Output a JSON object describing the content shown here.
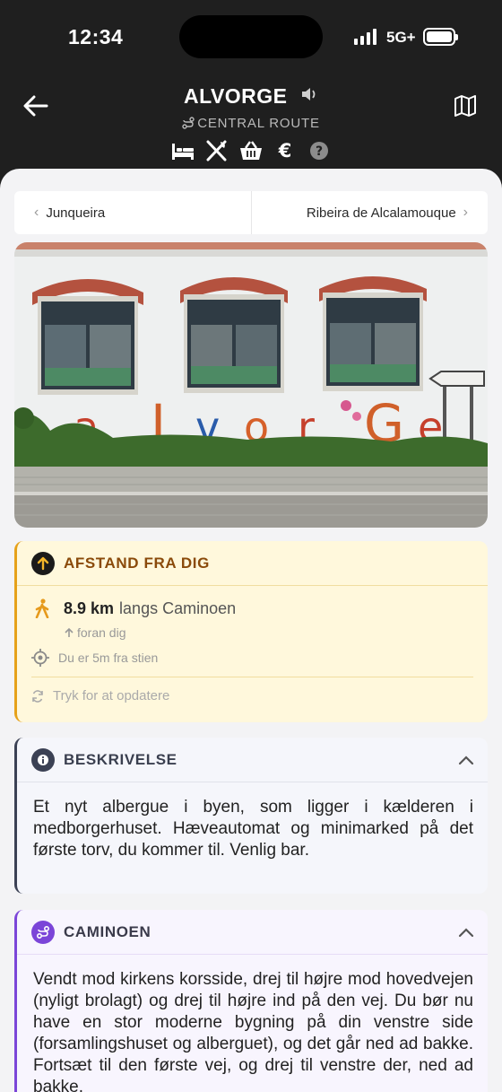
{
  "status": {
    "time": "12:34",
    "network": "5G+"
  },
  "header": {
    "title": "ALVORGE",
    "route": "CENTRAL ROUTE",
    "amenities": [
      "bed-icon",
      "fork-knife-icon",
      "basket-icon",
      "euro-icon",
      "question-icon"
    ]
  },
  "nav": {
    "prev": "Junqueira",
    "next": "Ribeira de Alcalamouque"
  },
  "photo": {
    "sign_letters": [
      "a",
      "L",
      "v",
      "o",
      "r",
      "G",
      "e"
    ]
  },
  "distance": {
    "title": "AFSTAND FRA DIG",
    "value": "8.9 km",
    "along": "langs Caminoen",
    "direction": "foran dig",
    "offset": "Du er 5m fra stien",
    "refresh": "Tryk for at opdatere"
  },
  "description": {
    "title": "BESKRIVELSE",
    "text": "Et nyt albergue i byen, som ligger i kælderen i medborgerhuset. Hæveautomat og minimarked på det første torv, du kommer til. Venlig bar."
  },
  "camino": {
    "title": "CAMINOEN",
    "text": "Vendt mod kirkens korsside, drej til højre mod hovedvejen (nyligt brolagt) og drej til højre ind på den vej. Du bør nu have en stor moderne bygning på din venstre side (forsamlingshuset og alberguet), og det går ned ad bakke. Fortsæt til den første vej, og drej til venstre der, ned ad bakke."
  },
  "colors": {
    "accent_orange": "#e6a119",
    "accent_purple": "#7b45d8",
    "dark_header": "#1f1f1f"
  }
}
